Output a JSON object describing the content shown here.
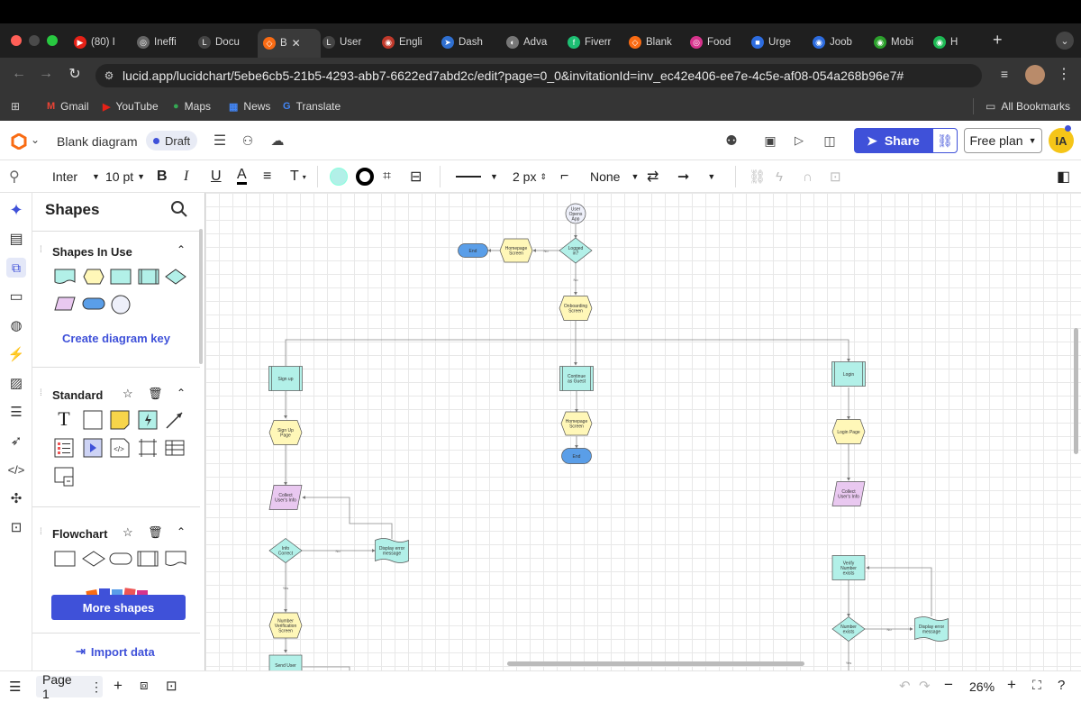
{
  "browser": {
    "tabs": [
      {
        "title": "(80) I",
        "color": "#e62117",
        "glyph": "▶"
      },
      {
        "title": "Ineffi",
        "color": "#666",
        "glyph": "◎"
      },
      {
        "title": "Docu",
        "color": "#444",
        "glyph": "L"
      },
      {
        "title": "B",
        "color": "#f96b13",
        "glyph": "◇",
        "active": true
      },
      {
        "title": "User",
        "color": "#444",
        "glyph": "L"
      },
      {
        "title": "Engli",
        "color": "#c0392b",
        "glyph": "◉"
      },
      {
        "title": "Dash",
        "color": "#2f6fd0",
        "glyph": "➤"
      },
      {
        "title": "Adva",
        "color": "#777",
        "glyph": "◐"
      },
      {
        "title": "Fiverr",
        "color": "#1dbf73",
        "glyph": "f"
      },
      {
        "title": "Blank",
        "color": "#f96b13",
        "glyph": "◇"
      },
      {
        "title": "Food",
        "color": "#d6338c",
        "glyph": "◎"
      },
      {
        "title": "Urge",
        "color": "#2d6cdf",
        "glyph": "■"
      },
      {
        "title": "Joob",
        "color": "#2d6cdf",
        "glyph": "◉"
      },
      {
        "title": "Mobi",
        "color": "#2ca02c",
        "glyph": "◉"
      },
      {
        "title": "H",
        "color": "#1db954",
        "glyph": "◉"
      }
    ],
    "new_tab_label": "+",
    "url": "lucid.app/lucidchart/5ebe6cb5-21b5-4293-abb7-6622ed7abd2c/edit?page=0_0&invitationId=inv_ec42e406-ee7e-4c5e-af08-054a268b96e7#",
    "bookmarks": [
      {
        "label": "Gmail",
        "color": "#ea4335",
        "glyph": "M"
      },
      {
        "label": "YouTube",
        "color": "#e62117",
        "glyph": "▶"
      },
      {
        "label": "Maps",
        "color": "#34a853",
        "glyph": "●"
      },
      {
        "label": "News",
        "color": "#4285f4",
        "glyph": "▦"
      },
      {
        "label": "Translate",
        "color": "#4285f4",
        "glyph": "G"
      }
    ],
    "all_bookmarks": "All Bookmarks"
  },
  "app": {
    "doc_title": "Blank diagram",
    "status_badge": "Draft",
    "share_label": "Share",
    "plan_label": "Free plan",
    "avatar_initials": "IA",
    "brand_color": "#f96b13",
    "share_color": "#3f51d9"
  },
  "format": {
    "font": "Inter",
    "size": "10 pt",
    "line_width": "2 px",
    "endpoint": "None",
    "fill_color": "#b2f0e8"
  },
  "sidebar": {
    "title": "Shapes",
    "in_use_title": "Shapes In Use",
    "create_key": "Create diagram key",
    "standard_title": "Standard",
    "flowchart_title": "Flowchart",
    "more_shapes": "More shapes",
    "import_data": "Import data"
  },
  "diagram": {
    "nodes": [
      {
        "id": "start",
        "label": [
          "User",
          "Opens",
          "App"
        ]
      },
      {
        "id": "end1",
        "label": [
          "End"
        ]
      },
      {
        "id": "home1",
        "label": [
          "Homepage",
          "Screen"
        ]
      },
      {
        "id": "logged",
        "label": [
          "Logged",
          "in?"
        ]
      },
      {
        "id": "onboard",
        "label": [
          "Onboarding",
          "Screen"
        ]
      },
      {
        "id": "signup",
        "label": [
          "Sign up"
        ]
      },
      {
        "id": "guest",
        "label": [
          "Continue",
          "as Guest"
        ]
      },
      {
        "id": "login",
        "label": [
          "Login"
        ]
      },
      {
        "id": "signuppage",
        "label": [
          "Sign Up",
          "Page"
        ]
      },
      {
        "id": "home2",
        "label": [
          "Homepage",
          "Screen"
        ]
      },
      {
        "id": "end2",
        "label": [
          "End"
        ]
      },
      {
        "id": "loginpage",
        "label": [
          "Login Page"
        ]
      },
      {
        "id": "collect1",
        "label": [
          "Collect",
          "User's Info"
        ]
      },
      {
        "id": "collect2",
        "label": [
          "Collect",
          "User's Info"
        ]
      },
      {
        "id": "infocorrect",
        "label": [
          "Info",
          "Correct"
        ]
      },
      {
        "id": "err1",
        "label": [
          "Display error",
          "message"
        ]
      },
      {
        "id": "verify",
        "label": [
          "Verify",
          "Number",
          "exists"
        ]
      },
      {
        "id": "numver",
        "label": [
          "Number",
          "Verification",
          "Screen"
        ]
      },
      {
        "id": "numexists",
        "label": [
          "Number",
          "exists"
        ]
      },
      {
        "id": "err2",
        "label": [
          "Display error",
          "message"
        ]
      },
      {
        "id": "senduser",
        "label": [
          "Send User"
        ]
      }
    ],
    "edge_labels": {
      "no1": "No",
      "no2": "No",
      "no3": "No",
      "no4": "No",
      "yes1": "Yes",
      "yes2": "Yes"
    }
  },
  "bottom": {
    "page_label": "Page 1",
    "zoom": "26%"
  }
}
